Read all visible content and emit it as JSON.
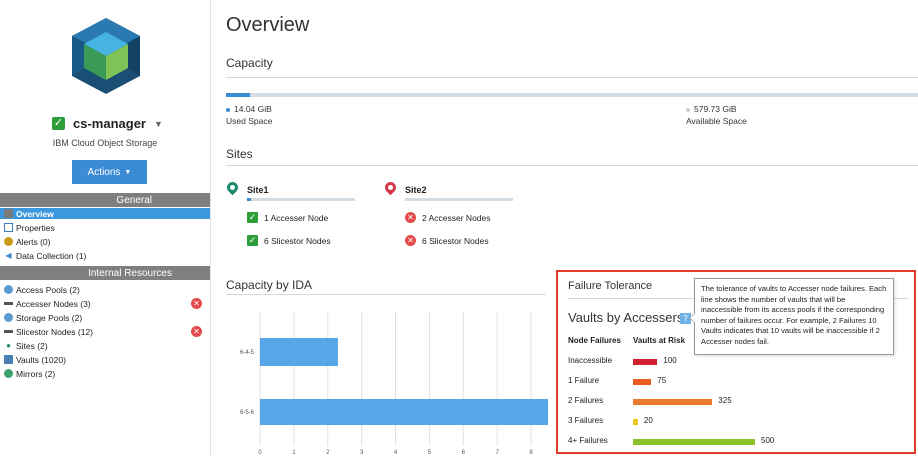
{
  "app": {
    "manager_name": "cs-manager",
    "product_name": "IBM Cloud Object Storage",
    "actions_label": "Actions"
  },
  "sidebar": {
    "general_header": "General",
    "general_items": [
      {
        "label": "Overview",
        "icon": "overview-icon",
        "active": true
      },
      {
        "label": "Properties",
        "icon": "properties-icon"
      },
      {
        "label": "Alerts (0)",
        "icon": "alert-icon"
      },
      {
        "label": "Data Collection (1)",
        "icon": "data-collection-icon"
      }
    ],
    "internal_header": "Internal Resources",
    "internal_items": [
      {
        "label": "Access Pools (2)",
        "icon": "access-pool-icon",
        "error": false
      },
      {
        "label": "Accesser Nodes (3)",
        "icon": "accesser-node-icon",
        "error": true
      },
      {
        "label": "Storage Pools (2)",
        "icon": "storage-pool-icon",
        "error": false
      },
      {
        "label": "Slicestor Nodes (12)",
        "icon": "slicestor-node-icon",
        "error": true
      },
      {
        "label": "Sites (2)",
        "icon": "site-pin-icon",
        "error": false
      },
      {
        "label": "Vaults (1020)",
        "icon": "vault-icon",
        "error": false
      },
      {
        "label": "Mirrors (2)",
        "icon": "mirror-icon",
        "error": false
      }
    ]
  },
  "overview": {
    "title": "Overview",
    "capacity": {
      "title": "Capacity",
      "used_value": "14.04 GiB",
      "used_label": "Used Space",
      "available_value": "579.73 GiB",
      "available_label": "Available Space",
      "used_fraction": 0.035
    },
    "sites": {
      "title": "Sites",
      "items": [
        {
          "name": "Site1",
          "pin_color": "#1f8a6b",
          "nodes": [
            {
              "label": "1 Accesser Node",
              "status": "ok"
            },
            {
              "label": "6 Slicestor Nodes",
              "status": "ok"
            }
          ]
        },
        {
          "name": "Site2",
          "pin_color": "#d63a4a",
          "nodes": [
            {
              "label": "2 Accesser Nodes",
              "status": "error"
            },
            {
              "label": "6 Slicestor Nodes",
              "status": "error"
            }
          ]
        }
      ]
    },
    "capacity_by_ida": {
      "title": "Capacity by IDA"
    },
    "failure_tolerance": {
      "title": "Failure Tolerance",
      "subtitle": "Vaults by Accessers",
      "col_failures": "Node Failures",
      "col_vaults": "Vaults at Risk",
      "rows": [
        {
          "label": "Inaccessible",
          "value": 100,
          "color": "#d11f2e"
        },
        {
          "label": "1 Failure",
          "value": 75,
          "color": "#e85a1e"
        },
        {
          "label": "2 Failures",
          "value": 325,
          "color": "#ee7a2e"
        },
        {
          "label": "3 Failures",
          "value": 20,
          "color": "#f2c51b"
        },
        {
          "label": "4+ Failures",
          "value": 500,
          "color": "#8bc12a"
        }
      ],
      "tooltip": "The tolerance of vaults to Accesser node failures. Each line shows the number of vaults that will be inaccessible from its access pools if the corresponding number of failures occur. For example, 2 Failures 10 Vaults indicates that 10 vaults will be inaccessible if 2 Accesser nodes fail."
    }
  },
  "chart_data": {
    "type": "bar",
    "orientation": "horizontal",
    "categories": [
      "6-4-5",
      "6-5-6"
    ],
    "values": [
      2.3,
      8.5
    ],
    "xlim": [
      0,
      8.5
    ],
    "x_ticks": [
      "0",
      "1",
      "2",
      "3",
      "4",
      "5",
      "6",
      "7",
      "8"
    ],
    "color": "#58a6ea",
    "grid": true
  }
}
